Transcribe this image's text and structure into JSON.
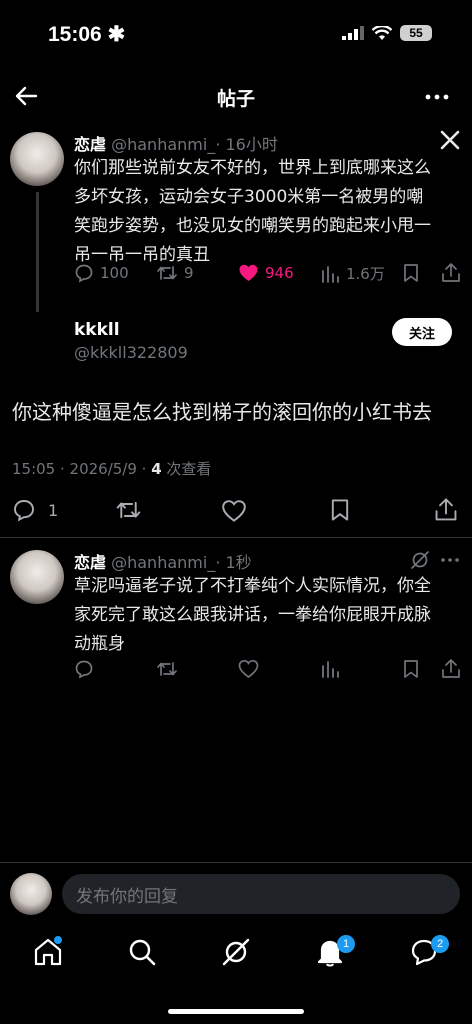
{
  "status": {
    "time": "15:06",
    "battery": "55"
  },
  "nav": {
    "title": "帖子"
  },
  "quoted_post": {
    "name": "恋虐",
    "handle": "@hanhanmi_",
    "time": "· 16小时",
    "lines": [
      "你们那些说前女友不好的，世界上到底哪来这么",
      "多坏女孩，运动会女子3000米第一名被男的嘲",
      "笑跑步姿势，也没见女的嘲笑男的跑起来小甩一",
      "吊一吊一吊的真丑"
    ],
    "replies": "100",
    "retweets": "9",
    "likes": "946",
    "views": "1.6万"
  },
  "main_post": {
    "name": "kkkll",
    "handle": "@kkkll322809",
    "follow_label": "关注",
    "text": "你这种傻逼是怎么找到梯子的滚回你的小红书去",
    "timestamp": "15:05 · 2026/5/9 · ",
    "view_count": "4",
    "view_label": " 次查看",
    "replies": "1"
  },
  "reply_post": {
    "name": "恋虐",
    "handle": "@hanhanmi_",
    "time": "· 1秒",
    "lines": [
      "草泥吗逼老子说了不打拳纯个人实际情况，你全",
      "家死完了敢这么跟我讲话，一拳给你屁眼开成脉",
      "动瓶身"
    ]
  },
  "composer": {
    "placeholder": "发布你的回复"
  },
  "bottom_nav": {
    "notifications_badge": "1",
    "messages_badge": "2"
  },
  "colors": {
    "accent": "#1d9bf0",
    "like": "#f91880",
    "muted": "#71767b"
  }
}
